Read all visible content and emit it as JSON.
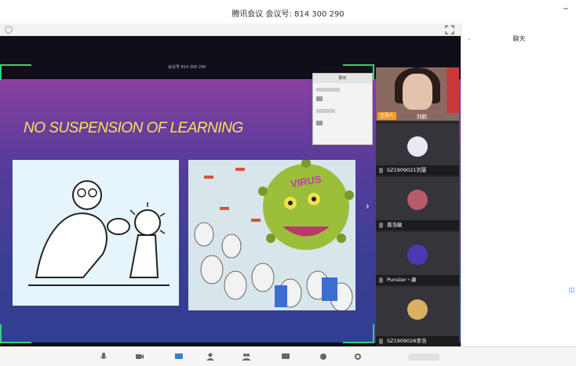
{
  "window": {
    "title": "腾讯会议 会议号: 814 300 290"
  },
  "share": {
    "meeting_tag": "会议号 814 300 290",
    "slide_title": "NO SUSPENSION OF LEARNING",
    "cartoon_virus_text": "VIRUS"
  },
  "mini_chat": {
    "title": "聊天"
  },
  "participants": {
    "host": {
      "badge": "主持人",
      "name": "刘鹤"
    },
    "tiles": [
      {
        "name": "SZ1909021刘慧"
      },
      {
        "name": "龚浩敏"
      },
      {
        "name": "Punster丶康"
      },
      {
        "name": "SZ1909026李浩"
      }
    ]
  },
  "chat_panel": {
    "title": "聊天"
  },
  "colors": {
    "slide_title": "#f3e45a",
    "host_badge": "#f39a2a",
    "bracket": "#35d07a"
  }
}
